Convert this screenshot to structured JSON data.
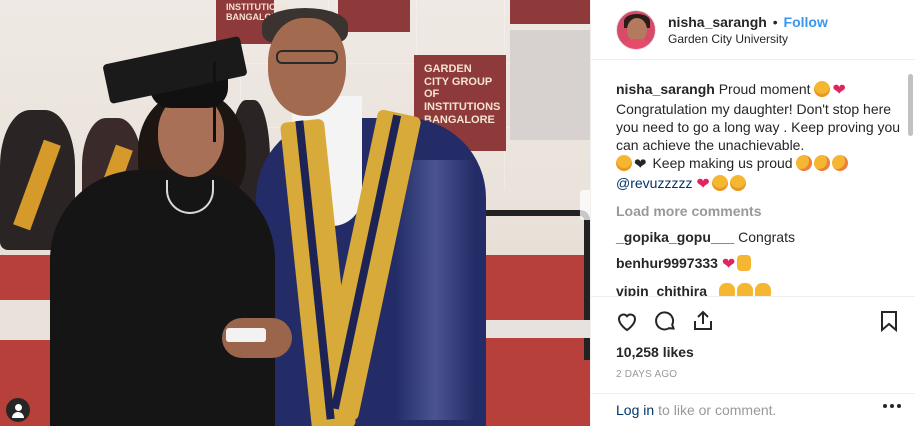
{
  "header": {
    "username": "nisha_sarangh",
    "separator": "•",
    "follow_label": "Follow",
    "location": "Garden City University"
  },
  "photo": {
    "banner_1": "Institutions Bangalore",
    "banner_2": "",
    "banner_3": "Garden City Group of Institutions Bangalore",
    "description_alt": ""
  },
  "caption": {
    "username": "nisha_sarangh",
    "text_1": "Proud moment",
    "text_2": "Congratulation my daughter! Don't stop here you need to go a long way . Keep proving you can achieve the unachievable.",
    "text_3": "Keep making us proud",
    "mention": "@revuzzzzz"
  },
  "load_more_label": "Load more comments",
  "comments": [
    {
      "username": "_gopika_gopu___",
      "text": "Congrats"
    },
    {
      "username": "benhur9997333",
      "text": ""
    },
    {
      "username": "vipin_chithira_",
      "text": ""
    }
  ],
  "icons": {
    "like": "heart-outline-icon",
    "comment": "comment-bubble-icon",
    "share": "share-icon",
    "save": "bookmark-icon",
    "more": "more-dots-icon",
    "user_tag": "user-tag-icon"
  },
  "likes": "10,258 likes",
  "date": "2 DAYS AGO",
  "footer": {
    "login_label": "Log in",
    "rest_label": "to like or comment."
  },
  "colors": {
    "link": "#3897f0",
    "text": "#262626",
    "muted": "#999999",
    "mention": "#003569",
    "border": "#efefef"
  }
}
